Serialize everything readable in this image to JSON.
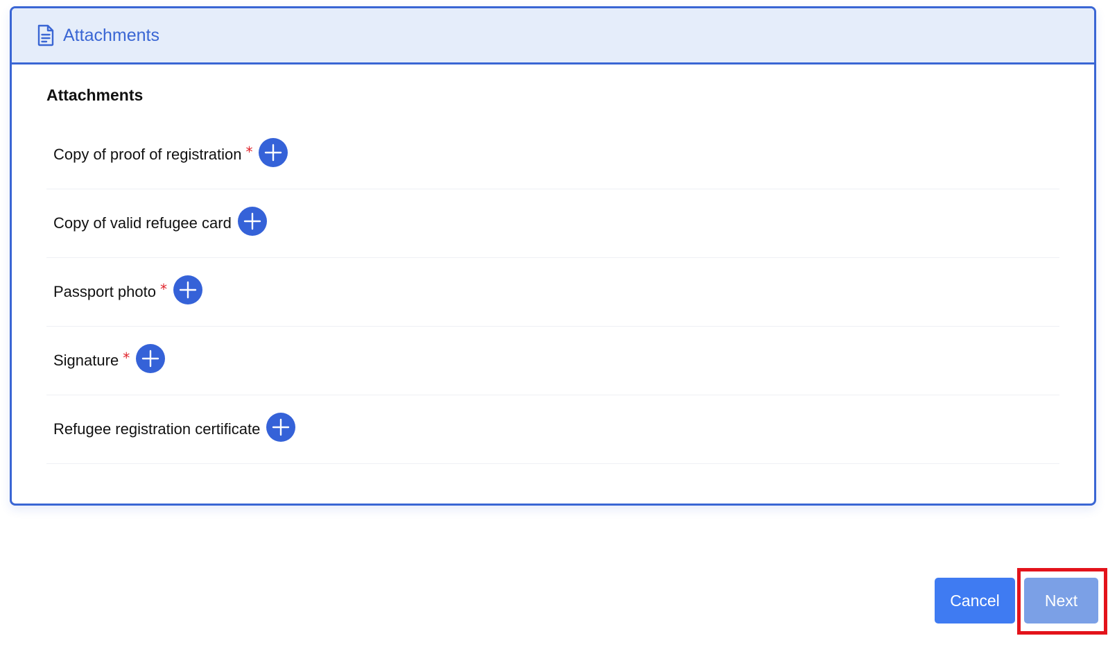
{
  "panel": {
    "header_title": "Attachments",
    "header_icon": "document-icon",
    "section_title": "Attachments"
  },
  "attachments": [
    {
      "label": "Copy of proof of registration",
      "required": true,
      "required_mark": "*"
    },
    {
      "label": "Copy of valid refugee card",
      "required": false,
      "required_mark": ""
    },
    {
      "label": "Passport photo",
      "required": true,
      "required_mark": "*"
    },
    {
      "label": "Signature",
      "required": true,
      "required_mark": "*"
    },
    {
      "label": "Refugee registration certificate",
      "required": false,
      "required_mark": ""
    }
  ],
  "footer": {
    "cancel_label": "Cancel",
    "next_label": "Next"
  },
  "colors": {
    "accent": "#3a66d4",
    "header_bg": "#e5edfa",
    "required": "#e0242b",
    "add_button": "#3562d8",
    "cancel_button": "#3f7bf2",
    "next_button_disabled": "#7ba0e6",
    "highlight": "#e3131b"
  }
}
